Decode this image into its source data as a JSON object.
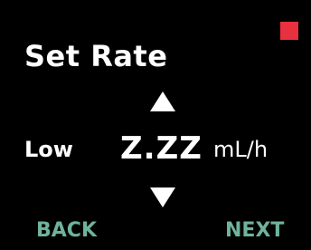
{
  "screen": {
    "title": "Set Rate",
    "status_indicator": {
      "icon": "red-square-icon",
      "color": "#e8303e"
    }
  },
  "rate": {
    "level": "Low",
    "value": "Z.ZZ",
    "unit": "mL/h",
    "increase_icon": "triangle-up-icon",
    "decrease_icon": "triangle-down-icon"
  },
  "softkeys": {
    "back_label": "BACK",
    "next_label": "NEXT",
    "color": "#6fb39b"
  }
}
